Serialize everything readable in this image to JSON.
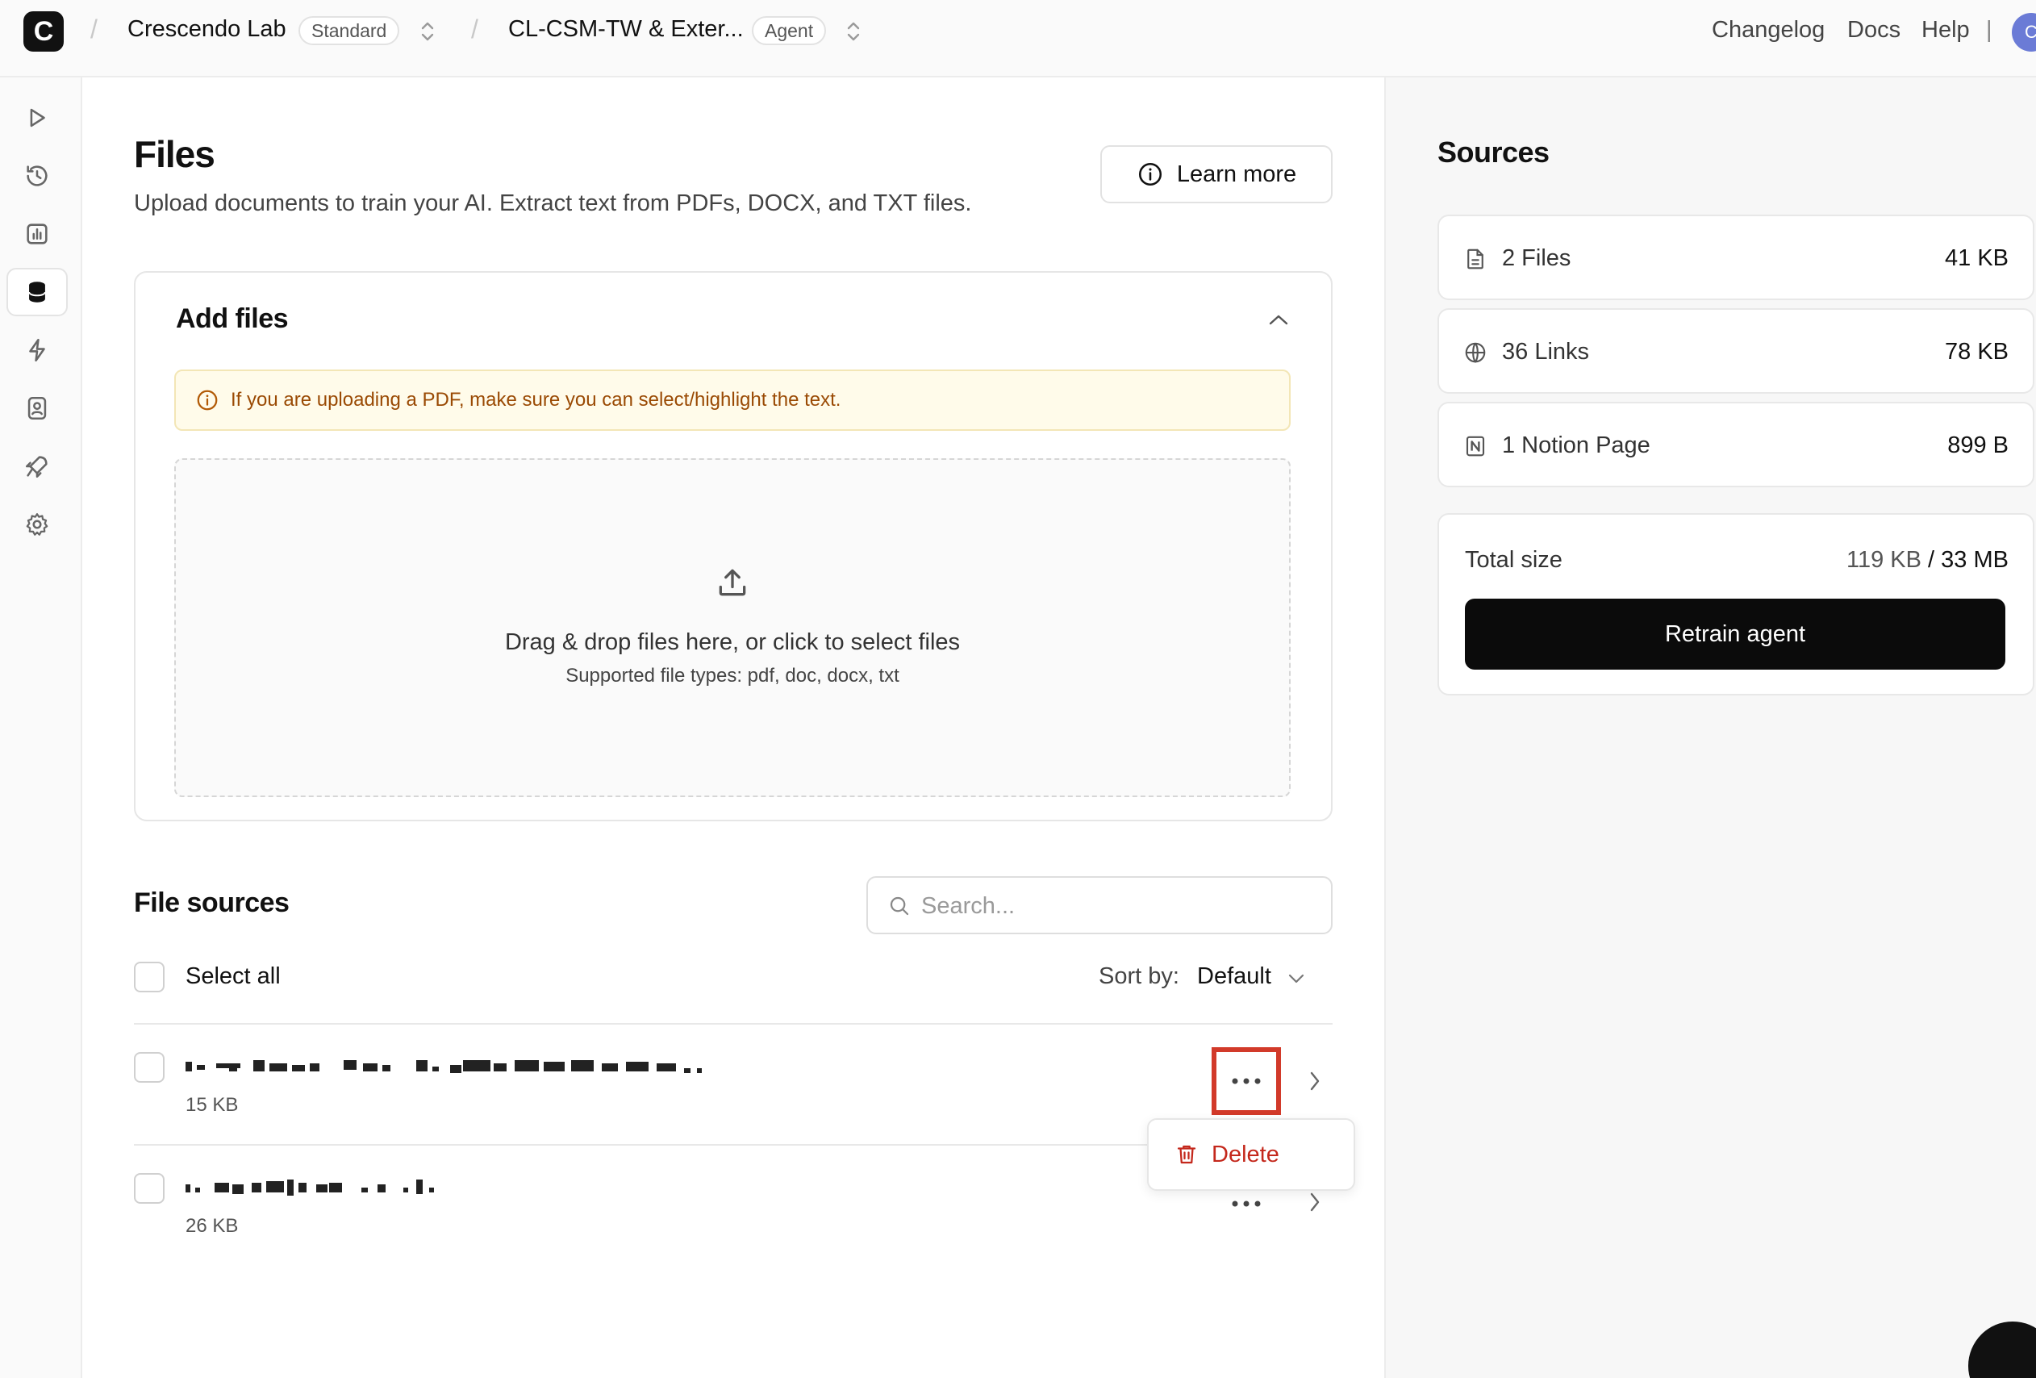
{
  "topbar": {
    "logo_letter": "C",
    "workspace": "Crescendo Lab",
    "workspace_plan": "Standard",
    "agent_name": "CL-CSM-TW & Exter...",
    "agent_badge": "Agent",
    "links": [
      "Changelog",
      "Docs",
      "Help"
    ],
    "separator": "|",
    "avatar_letter": "C"
  },
  "rail": {
    "items": [
      {
        "name": "playground",
        "icon": "play-icon"
      },
      {
        "name": "activity",
        "icon": "history-icon"
      },
      {
        "name": "analytics",
        "icon": "chart-icon"
      },
      {
        "name": "sources",
        "icon": "database-icon",
        "active": true
      },
      {
        "name": "actions",
        "icon": "bolt-icon"
      },
      {
        "name": "contacts",
        "icon": "contact-icon"
      },
      {
        "name": "deploy",
        "icon": "rocket-icon"
      },
      {
        "name": "settings",
        "icon": "gear-icon"
      }
    ]
  },
  "main": {
    "title": "Files",
    "subtitle": "Upload documents to train your AI. Extract text from PDFs, DOCX, and TXT files.",
    "learn_more": "Learn more",
    "add_files": {
      "title": "Add files",
      "notice": "If you are uploading a PDF, make sure you can select/highlight the text.",
      "drop_main": "Drag & drop files here, or click to select files",
      "drop_sub": "Supported file types: pdf, doc, docx, txt"
    },
    "file_sources": {
      "title": "File sources",
      "search_placeholder": "Search...",
      "select_all": "Select all",
      "sort_label": "Sort by:",
      "sort_value": "Default",
      "files": [
        {
          "size": "15 KB"
        },
        {
          "size": "26 KB"
        }
      ],
      "menu": {
        "delete": "Delete"
      }
    }
  },
  "sources": {
    "title": "Sources",
    "items": [
      {
        "label": "2 Files",
        "size": "41 KB",
        "icon": "file-icon"
      },
      {
        "label": "36 Links",
        "size": "78 KB",
        "icon": "globe-icon"
      },
      {
        "label": "1 Notion Page",
        "size": "899 B",
        "icon": "notion-icon"
      }
    ],
    "total_label": "Total size",
    "total_used": "119 KB",
    "total_sep": " / ",
    "total_limit": "33 MB",
    "retrain": "Retrain agent"
  },
  "colors": {
    "accent": "#0b0b0b",
    "notice_bg": "#fffbea",
    "notice_text": "#9a4a04",
    "danger": "#c4281c",
    "highlight": "#d23a2a"
  }
}
